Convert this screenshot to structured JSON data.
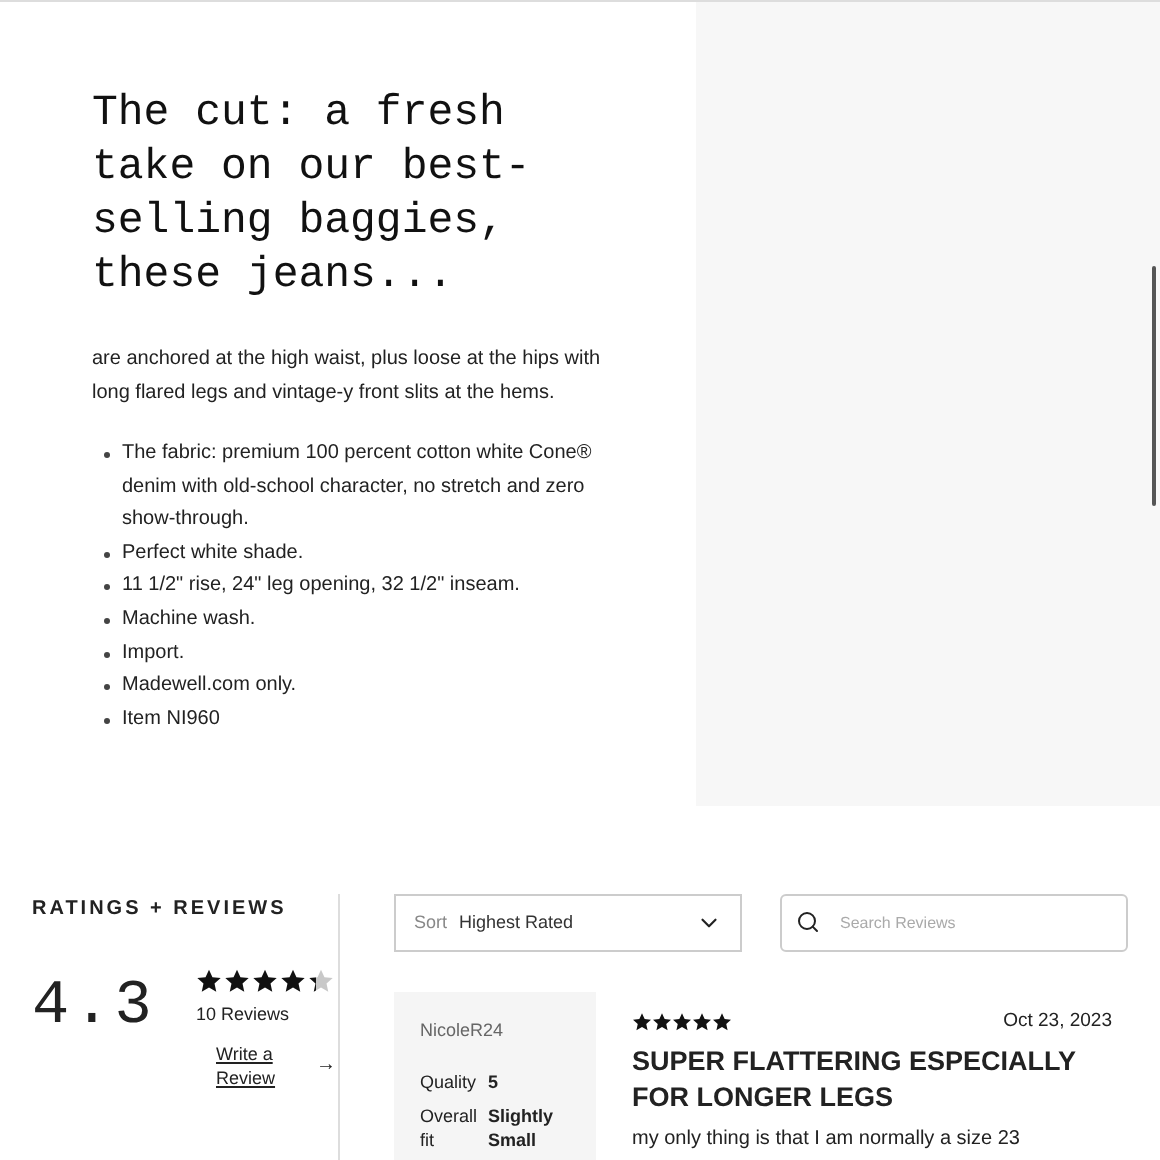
{
  "description": {
    "heading": "The cut: a fresh take on our best-selling baggies, these jeans...",
    "intro": "are anchored at the high waist, plus loose at the hips with long flared legs and vintage-y front slits at the hems.",
    "bullets": [
      "The fabric: premium 100 percent cotton white Cone® denim with old-school character, no stretch and zero show-through.",
      "Perfect white shade.",
      "11 1/2\" rise, 24\" leg opening, 32 1/2\" inseam.",
      "Machine wash.",
      "Import.",
      "Madewell.com only.",
      "Item NI960"
    ]
  },
  "reviews": {
    "title": "RATINGS + REVIEWS",
    "average": "4.3",
    "stars": 4.3,
    "count": "10 Reviews",
    "write_link": "Write a Review",
    "arrow": "→",
    "sort": {
      "label": "Sort",
      "value": "Highest Rated"
    },
    "search": {
      "placeholder": "Search Reviews"
    },
    "items": [
      {
        "author": "NicoleR24",
        "attributes": [
          {
            "label": "Quality",
            "value": "5"
          },
          {
            "label": "Overall fit",
            "value": "Slightly Small"
          }
        ],
        "stars": 5,
        "date": "Oct 23, 2023",
        "headline": "SUPER FLATTERING ESPECIALLY FOR LONGER LEGS",
        "body": "my only thing is that I am normally a size 23"
      }
    ]
  }
}
